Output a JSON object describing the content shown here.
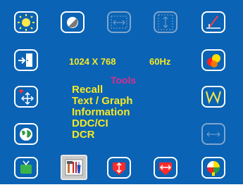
{
  "status": {
    "resolution": "1024 X 768",
    "refresh_rate": "60Hz"
  },
  "menu": {
    "title": "Tools",
    "items": [
      "Recall",
      "Text / Graph",
      "Information",
      "DDC/CI",
      "DCR"
    ]
  },
  "icons": {
    "top_row": [
      "brightness-icon",
      "contrast-icon",
      "h-size-icon",
      "v-size-icon",
      "sharpness-icon"
    ],
    "left_column": [
      "exit-icon",
      "position-icon",
      "language-icon"
    ],
    "right_column": [
      "color-icon",
      "waveform-icon",
      "h-position-icon"
    ],
    "bottom_row": [
      "tv-icon",
      "tools-icon",
      "v-arrows-icon",
      "h-arrows-icon",
      "palette-icon"
    ],
    "selected": "tools-icon"
  },
  "colors": {
    "background": "#0a63b4",
    "menu_text": "#f6e925",
    "title": "#d62f93",
    "selected_bg": "#c8c8c8"
  }
}
